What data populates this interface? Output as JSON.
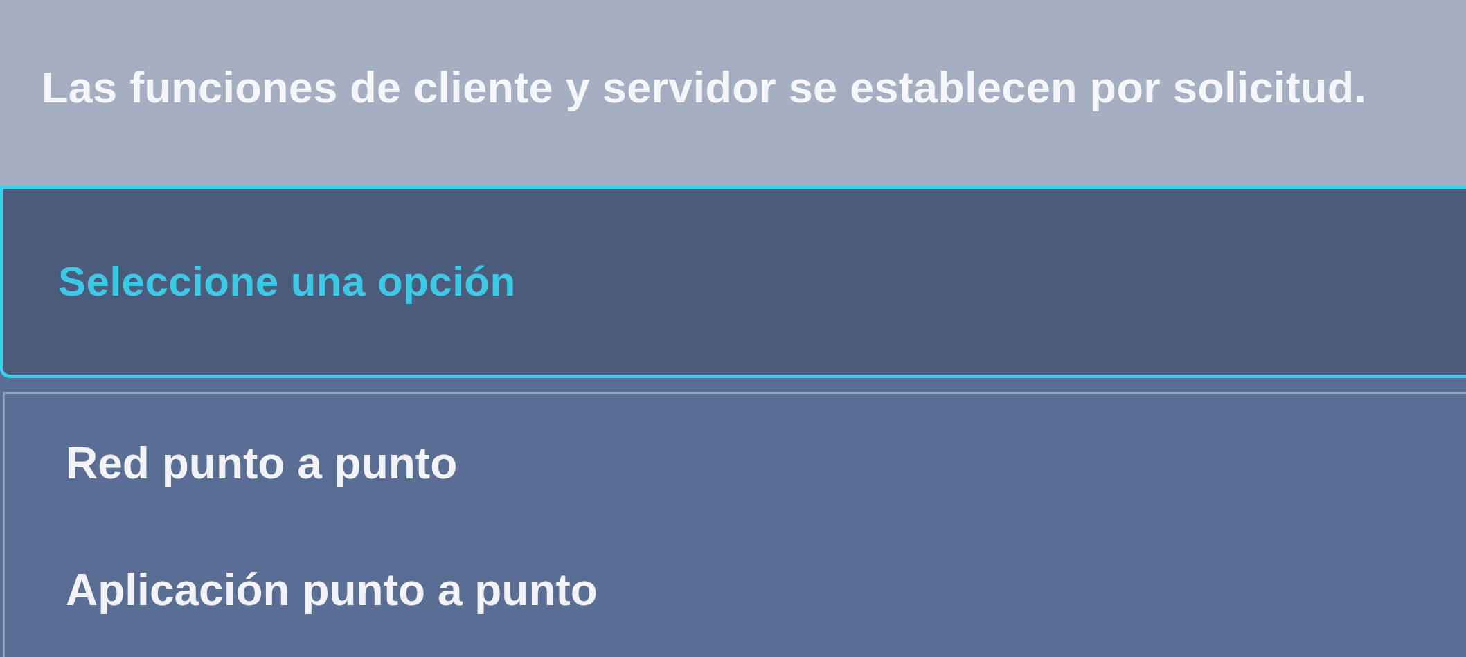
{
  "question": {
    "text": "Las funciones de cliente y servidor se establecen por solicitud."
  },
  "select": {
    "placeholder": "Seleccione una opción",
    "expanded": true
  },
  "options": [
    {
      "label": "Red punto a punto",
      "selected": false
    },
    {
      "label": "Aplicación punto a punto",
      "selected": false
    }
  ]
}
